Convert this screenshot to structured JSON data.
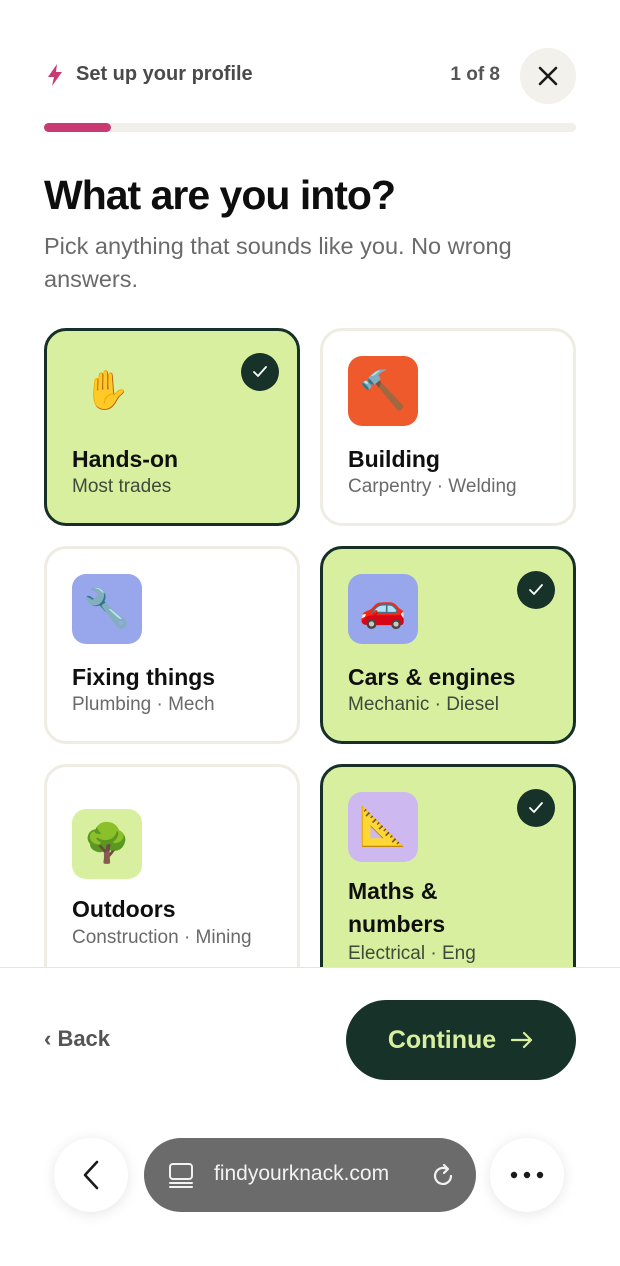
{
  "header": {
    "title": "Set up your profile",
    "step_count": "1 of 8",
    "accent": "#c93a75"
  },
  "progress": {
    "value": 0.125
  },
  "main": {
    "title": "What are you into?",
    "subtitle": "Pick anything that sounds like you. No wrong answers."
  },
  "interests": [
    {
      "label": "Hands-on",
      "sub": "Most trades",
      "icon": "raised-hand-icon",
      "emoji": "✋",
      "tile_color": "#d8ef9f",
      "selected": true
    },
    {
      "label": "Building",
      "sub": "Carpentry · Welding",
      "icon": "hammer-icon",
      "emoji": "🔨",
      "tile_color": "#ee5a2c",
      "selected": false
    },
    {
      "label": "Fixing things",
      "sub": "Plumbing · Mech",
      "icon": "wrench-icon",
      "emoji": "🔧",
      "tile_color": "#98a6ec",
      "selected": false
    },
    {
      "label": "Cars & engines",
      "sub": "Mechanic · Diesel",
      "icon": "car-icon",
      "emoji": "🚗",
      "tile_color": "#98a6ec",
      "selected": true
    },
    {
      "label": "Outdoors",
      "sub": "Construction · Mining",
      "icon": "tree-icon",
      "emoji": "🌳",
      "tile_color": "#d8ef9f",
      "selected": false
    },
    {
      "label": "Maths & numbers",
      "sub": "Electrical · Eng",
      "icon": "triangular-ruler-icon",
      "emoji": "📐",
      "tile_color": "#cdb8f0",
      "selected": true
    }
  ],
  "footer": {
    "back_label": "‹ Back",
    "continue_label": "Continue"
  },
  "browser": {
    "url": "findyourknack.com"
  },
  "colors": {
    "selected_bg": "#d8ef9f",
    "selected_border": "#163028",
    "primary_button": "#173228"
  }
}
